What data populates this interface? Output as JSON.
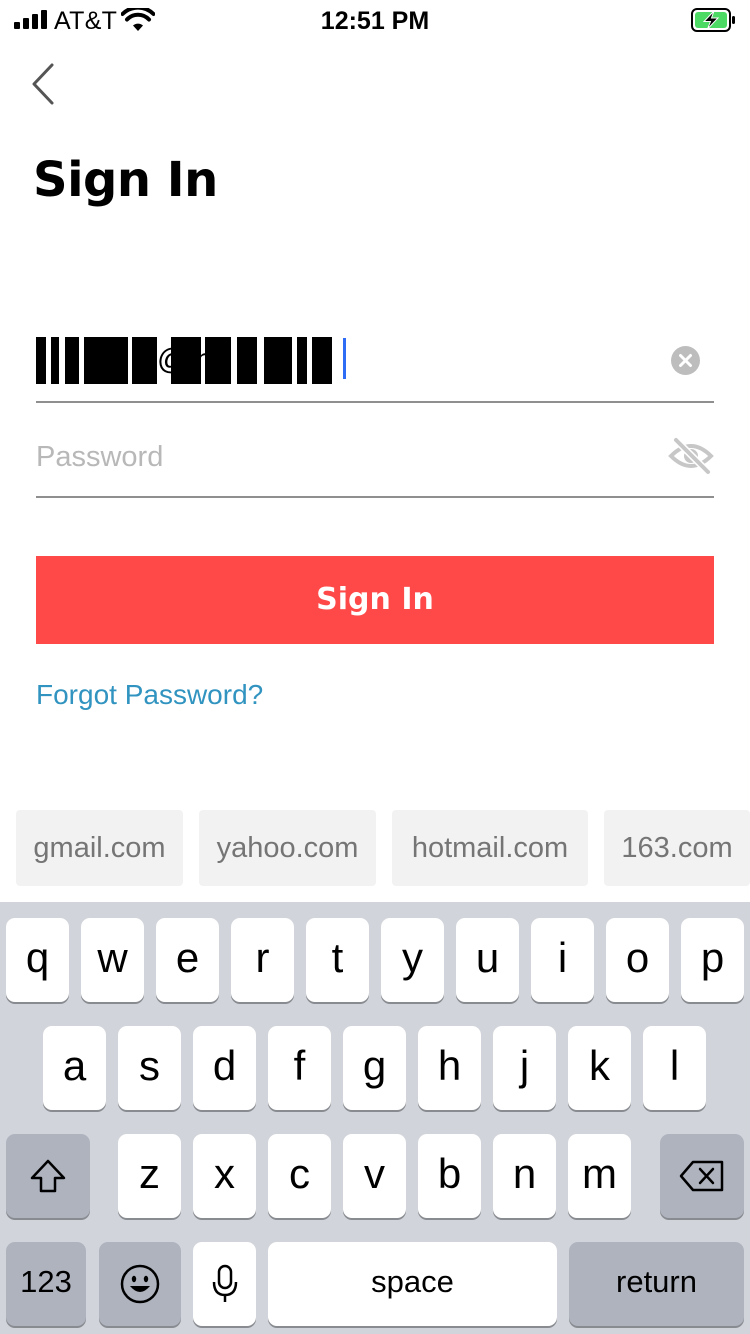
{
  "status_bar": {
    "carrier": "AT&T",
    "time": "12:51 PM",
    "signal_bars": 4,
    "battery_state": "charging",
    "battery_color": "#4cd964"
  },
  "header": {
    "back_icon": "chevron-left-icon",
    "title": "Sign In"
  },
  "form": {
    "email_value_visible": "@ n",
    "email_redacted": true,
    "clear_icon": "clear-circle-icon",
    "password_placeholder": "Password",
    "password_value": "",
    "visibility_icon": "eye-off-icon",
    "signin_label": "Sign In",
    "forgot_label": "Forgot Password?"
  },
  "colors": {
    "primary": "#ff4949",
    "link": "#3194c0",
    "caret": "#2f6cf5"
  },
  "suggestions": [
    "gmail.com",
    "yahoo.com",
    "hotmail.com",
    "163.com"
  ],
  "keyboard": {
    "row1": [
      "q",
      "w",
      "e",
      "r",
      "t",
      "y",
      "u",
      "i",
      "o",
      "p"
    ],
    "row2": [
      "a",
      "s",
      "d",
      "f",
      "g",
      "h",
      "j",
      "k",
      "l"
    ],
    "row3": [
      "z",
      "x",
      "c",
      "v",
      "b",
      "n",
      "m"
    ],
    "shift_icon": "shift-icon",
    "delete_icon": "backspace-icon",
    "numbers_label": "123",
    "emoji_icon": "emoji-icon",
    "mic_icon": "microphone-icon",
    "space_label": "space",
    "return_label": "return"
  }
}
